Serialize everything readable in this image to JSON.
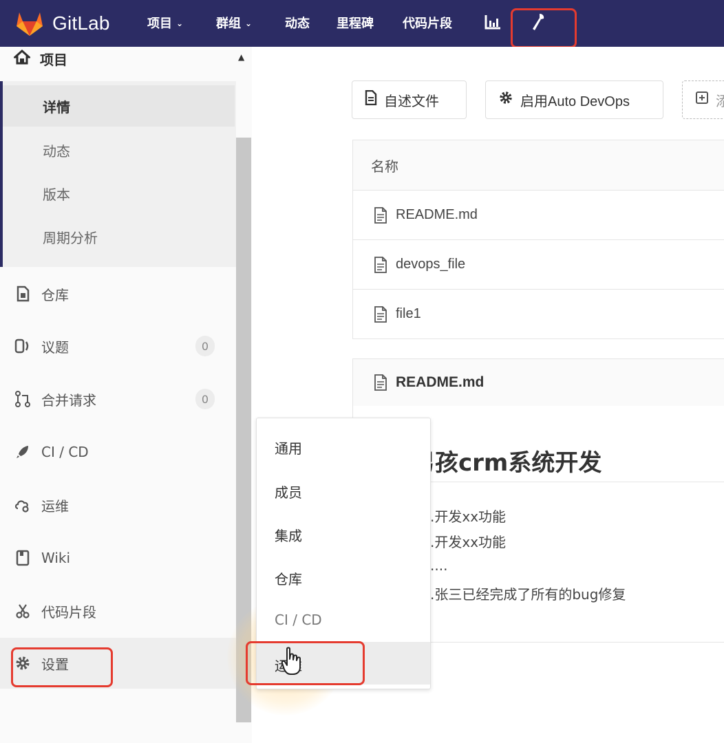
{
  "nav": {
    "brand": "GitLab",
    "items": [
      {
        "label": "项目",
        "dropdown": true
      },
      {
        "label": "群组",
        "dropdown": true
      },
      {
        "label": "动态"
      },
      {
        "label": "里程碑"
      },
      {
        "label": "代码片段"
      }
    ],
    "icons": [
      "chart-icon",
      "wrench-icon"
    ]
  },
  "sidebar": {
    "project_label": "项目",
    "sub_items": [
      "详情",
      "动态",
      "版本",
      "周期分析"
    ],
    "active_sub": "详情",
    "items": [
      {
        "label": "仓库",
        "icon": "repository-icon"
      },
      {
        "label": "议题",
        "icon": "issues-icon",
        "count": "0"
      },
      {
        "label": "合并请求",
        "icon": "merge-request-icon",
        "count": "0"
      },
      {
        "label": "CI / CD",
        "icon": "rocket-icon"
      },
      {
        "label": "运维",
        "icon": "cloud-gear-icon"
      },
      {
        "label": "Wiki",
        "icon": "book-icon"
      },
      {
        "label": "代码片段",
        "icon": "scissors-icon"
      },
      {
        "label": "设置",
        "icon": "gear-icon"
      }
    ]
  },
  "toolbar": {
    "readme_btn": "自述文件",
    "devops_btn": "启用Auto DevOps",
    "add_btn": "添"
  },
  "files": {
    "header": "名称",
    "rows": [
      "README.md",
      "devops_file",
      "file1"
    ]
  },
  "readme": {
    "filename": "README.md",
    "title": "男孩crm系统开发",
    "lines": [
      ".开发xx功能",
      ".开发xx功能",
      "....",
      ".张三已经完成了所有的bug修复"
    ]
  },
  "settings_menu": {
    "items": [
      "通用",
      "成员",
      "集成",
      "仓库",
      "CI / CD",
      "运维"
    ],
    "hovered": "运维"
  },
  "colors": {
    "nav_bg": "#2c2c64",
    "highlight": "#e53b2f",
    "gitlab_orange": "#e8733a"
  }
}
